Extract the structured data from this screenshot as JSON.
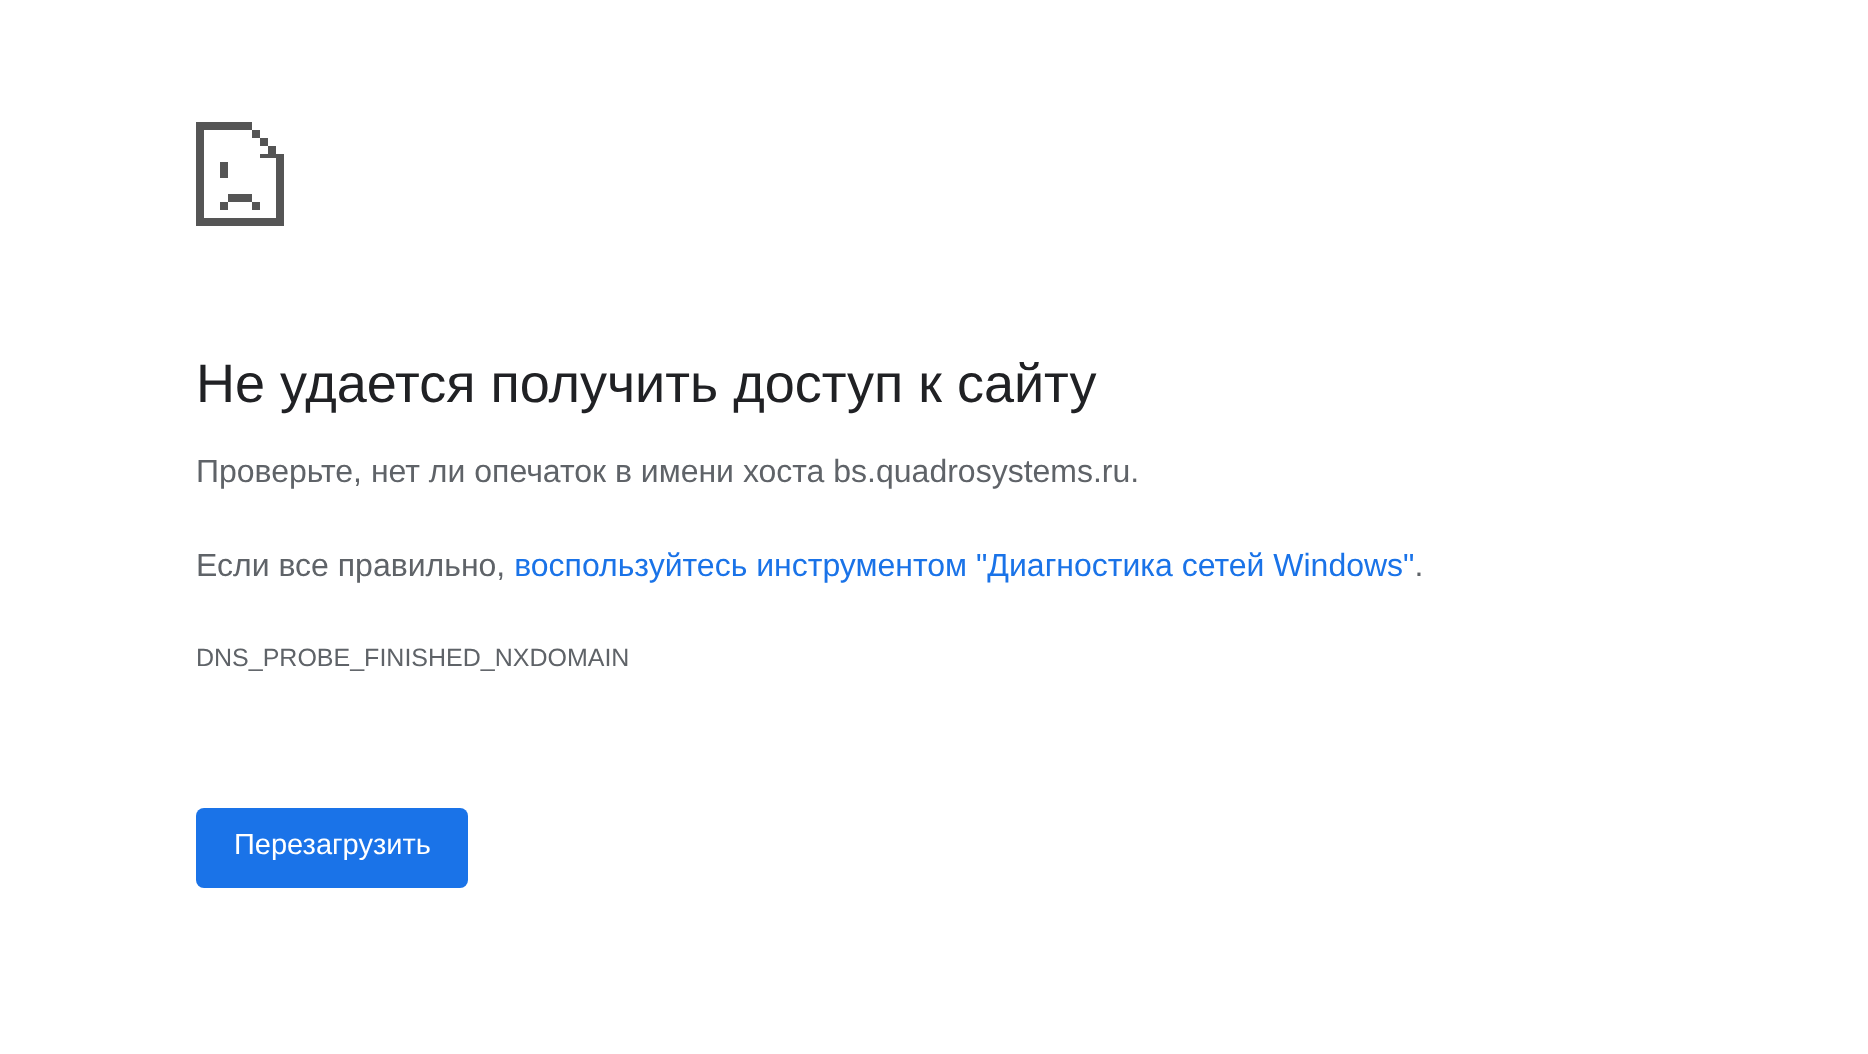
{
  "heading": "Не удается получить доступ к сайту",
  "hint": "Проверьте, нет ли опечаток в имени хоста bs.quadrosystems.ru.",
  "suggestion": {
    "before": "Если все правильно, ",
    "link": "воспользуйтесь инструментом \"Диагностика сетей Windows\"",
    "after": "."
  },
  "error_code": "DNS_PROBE_FINISHED_NXDOMAIN",
  "button": "Перезагрузить"
}
